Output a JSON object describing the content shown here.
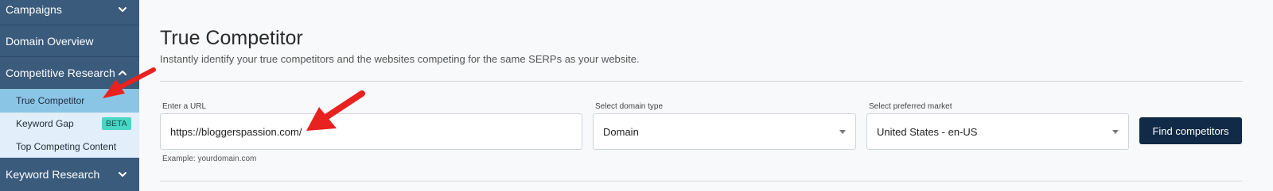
{
  "sidebar": {
    "campaigns_label": "Campaigns",
    "domain_overview_label": "Domain Overview",
    "competitive_research_label": "Competitive Research",
    "sub_items": {
      "true_competitor": "True Competitor",
      "keyword_gap": "Keyword Gap",
      "keyword_gap_badge": "BETA",
      "top_competing_content": "Top Competing Content"
    },
    "keyword_research_label": "Keyword Research"
  },
  "page": {
    "title": "True Competitor",
    "subtitle": "Instantly identify your true competitors and the websites competing for the same SERPs as your website."
  },
  "form": {
    "url_label": "Enter a URL",
    "url_value": "https://bloggerspassion.com/",
    "url_example": "Example: yourdomain.com",
    "domain_type_label": "Select domain type",
    "domain_type_value": "Domain",
    "market_label": "Select preferred market",
    "market_value": "United States - en-US",
    "submit_label": "Find competitors"
  },
  "colors": {
    "sidebar_bg": "#3a5b7c",
    "submenu_bg": "#e2eef9",
    "active_item_bg": "#8bc5e6",
    "beta_badge_bg": "#49d6c5",
    "button_bg": "#102a47",
    "annotation_arrow": "#e8221f"
  },
  "icons": {
    "campaigns_chevron": "chevron-down-icon",
    "competitive_research_chevron": "chevron-up-icon",
    "keyword_research_chevron": "chevron-down-icon",
    "select_caret": "caret-down-icon",
    "annotation": "red-arrow-annotation"
  }
}
